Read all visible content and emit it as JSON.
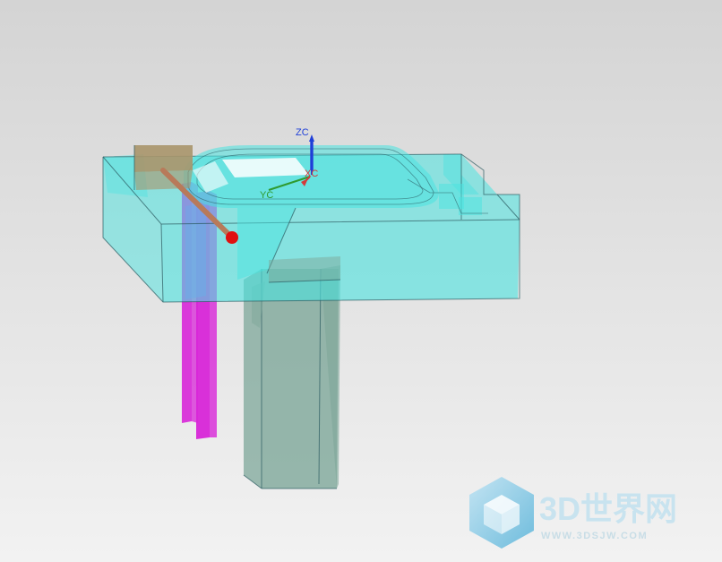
{
  "viewport": {
    "background_top": "#d4d4d4",
    "background_bottom": "#f2f2f2"
  },
  "axes": {
    "z_label": "ZC",
    "y_label": "YC",
    "x_label": "XC",
    "z_color": "#1f3fd8",
    "y_color": "#2f9a2f",
    "x_color": "#d23a3a"
  },
  "model": {
    "mold_color": "#49e3e0",
    "insert_color": "#7ea79a",
    "pin_color": "#d826d8",
    "pin_alt_color": "#9a5ef0",
    "block_color": "#a9956a",
    "rod_color": "#b87a5a",
    "marker_color": "#e01010",
    "edge_color": "#2a5a60"
  },
  "watermark": {
    "title": "3D世界网",
    "url": "WWW.3DSJW.COM",
    "icon": "cube-logo-icon"
  }
}
